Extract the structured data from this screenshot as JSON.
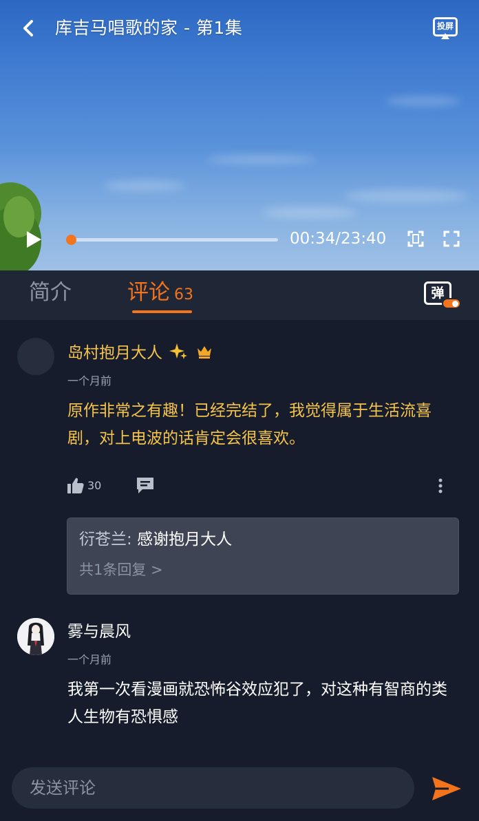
{
  "player": {
    "title": "库吉马唱歌的家 - 第1集",
    "cast_label": "投屏",
    "time": "00:34/23:40",
    "progress": 0.024
  },
  "tabs": {
    "intro_label": "简介",
    "comments_label": "评论",
    "comments_count": "63",
    "danmaku_label": "弹"
  },
  "comments": [
    {
      "user": "岛村抱月大人",
      "time": "一个月前",
      "content": "原作非常之有趣！已经完结了，我觉得属于生活流喜剧，对上电波的话肯定会很喜欢。",
      "likes": "30",
      "reply": {
        "author": "衍苍兰:",
        "text": "感谢抱月大人",
        "more": "共1条回复 >"
      }
    },
    {
      "user": "雾与晨风",
      "time": "一个月前",
      "content": "我第一次看漫画就恐怖谷效应犯了，对这种有智商的类人生物有恐惧感"
    }
  ],
  "input": {
    "placeholder": "发送评论"
  },
  "colors": {
    "accent": "#f3741c",
    "username_highlight": "#f5c44a",
    "background": "#161c2b",
    "tab_bar": "#1f2635"
  }
}
